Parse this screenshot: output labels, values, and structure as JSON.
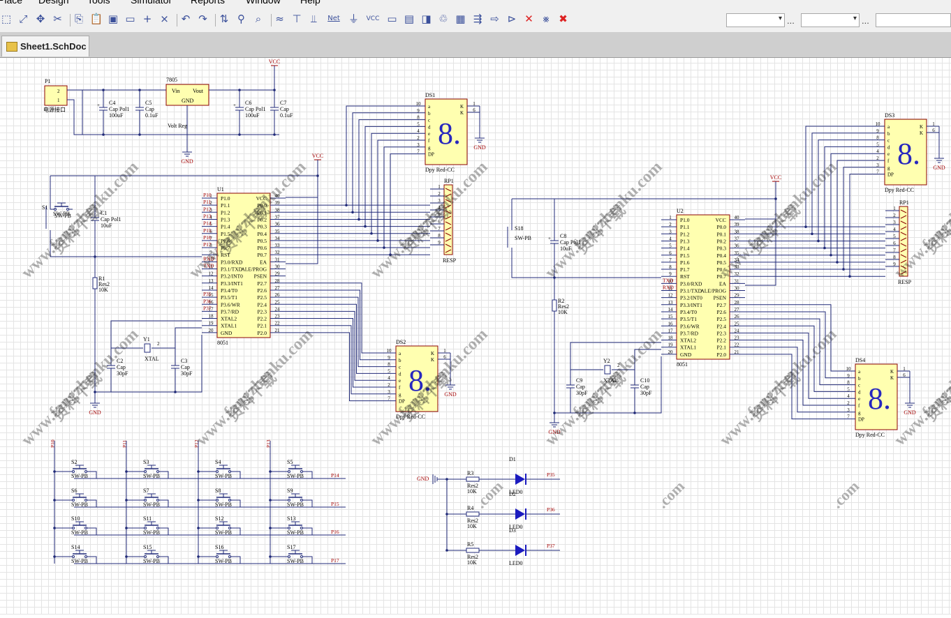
{
  "menu": [
    "Place",
    "Design",
    "Tools",
    "Simulator",
    "Reports",
    "Window",
    "Help"
  ],
  "tab": {
    "label": "Sheet1.SchDoc"
  },
  "toolbar": {
    "icons": [
      "select-area-icon",
      "select-icon",
      "move-icon",
      "cut-icon",
      "copy-icon",
      "paste-icon",
      "rubber-stamp-icon",
      "rectangle-select-icon",
      "cross-icon",
      "clear-icon",
      "undo-icon",
      "redo-icon",
      "parent-child-icon",
      "probe-icon",
      "browse-icon",
      "wire-icon",
      "bus-icon",
      "bus-entry-icon",
      "netlabel-icon",
      "gnd-port-icon",
      "vcc-port-icon",
      "part-icon",
      "sheet-icon",
      "sheet-entry-icon",
      "device-sheet-icon",
      "harness-icon",
      "port-icon",
      "off-sheet-icon",
      "no-erc-icon",
      "compile-icon",
      "cross-probe-icon",
      "delete-icon"
    ],
    "netlabel_text": "Net",
    "vcc_text": "VCC",
    "combo1": "",
    "combo2": "",
    "combo3": "",
    "ellipsis": "..."
  },
  "watermark": {
    "cn": "资料下载",
    "url": "www.fangzhenku.com",
    "tail": ".com"
  },
  "power": {
    "p1": {
      "ref": "P1",
      "pins": [
        "2",
        "1"
      ],
      "label": "电源接口"
    },
    "u7805": {
      "ref": "7805",
      "pin_in": "Vin",
      "pin_out": "Vout",
      "pin_gnd": "GND",
      "label": "Volt Reg"
    },
    "c4": {
      "ref": "C4",
      "type": "Cap Pol1",
      "value": "100uF"
    },
    "c5": {
      "ref": "C5",
      "type": "Cap",
      "value": "0.1uF"
    },
    "c6": {
      "ref": "C6",
      "type": "Cap Pol1",
      "value": "100uF"
    },
    "c7": {
      "ref": "C7",
      "type": "Cap",
      "value": "0.1uF"
    },
    "vcc": "VCC",
    "gnd": "GND"
  },
  "left_mcu": {
    "ref": "U1",
    "name": "8051",
    "left_pins": [
      {
        "num": "1",
        "name": "P1.0",
        "net": "P10"
      },
      {
        "num": "2",
        "name": "P1.1",
        "net": "P11"
      },
      {
        "num": "3",
        "name": "P1.2",
        "net": "P12"
      },
      {
        "num": "4",
        "name": "P1.3",
        "net": "P13"
      },
      {
        "num": "5",
        "name": "P1.4",
        "net": "P14"
      },
      {
        "num": "6",
        "name": "P1.5",
        "net": "P15"
      },
      {
        "num": "7",
        "name": "P1.6",
        "net": "P16"
      },
      {
        "num": "8",
        "name": "P1.7",
        "net": "P17"
      },
      {
        "num": "9",
        "name": "RST",
        "net": ""
      },
      {
        "num": "10",
        "name": "P3.0/RXD",
        "net": "RXD"
      },
      {
        "num": "11",
        "name": "P3.1/TXD",
        "net": "TXD"
      },
      {
        "num": "12",
        "name": "P3.2/INT0",
        "net": ""
      },
      {
        "num": "13",
        "name": "P3.3/INT1",
        "net": ""
      },
      {
        "num": "14",
        "name": "P3.4/T0",
        "net": ""
      },
      {
        "num": "15",
        "name": "P3.5/T1",
        "net": "P35"
      },
      {
        "num": "16",
        "name": "P3.6/WR",
        "net": "P36"
      },
      {
        "num": "17",
        "name": "P3.7/RD",
        "net": "P37"
      },
      {
        "num": "18",
        "name": "XTAL2",
        "net": ""
      },
      {
        "num": "19",
        "name": "XTAL1",
        "net": ""
      },
      {
        "num": "20",
        "name": "GND",
        "net": ""
      }
    ],
    "right_pins": [
      {
        "num": "40",
        "name": "VCC"
      },
      {
        "num": "39",
        "name": "P0.0"
      },
      {
        "num": "38",
        "name": "P0.1"
      },
      {
        "num": "37",
        "name": "P0.2"
      },
      {
        "num": "36",
        "name": "P0.3"
      },
      {
        "num": "35",
        "name": "P0.4"
      },
      {
        "num": "34",
        "name": "P0.5"
      },
      {
        "num": "33",
        "name": "P0.6"
      },
      {
        "num": "32",
        "name": "P0.7"
      },
      {
        "num": "31",
        "name": "EA"
      },
      {
        "num": "30",
        "name": "ALE/PROG"
      },
      {
        "num": "29",
        "name": "PSEN"
      },
      {
        "num": "28",
        "name": "P2.7"
      },
      {
        "num": "27",
        "name": "P2.6"
      },
      {
        "num": "26",
        "name": "P2.5"
      },
      {
        "num": "25",
        "name": "P2.4"
      },
      {
        "num": "24",
        "name": "P2.3"
      },
      {
        "num": "23",
        "name": "P2.2"
      },
      {
        "num": "22",
        "name": "P2.1"
      },
      {
        "num": "21",
        "name": "P2.0"
      }
    ],
    "vcc": "VCC",
    "s_reset": {
      "ref": "S1",
      "type": "SW-PB"
    },
    "c1": {
      "ref": "C1",
      "type": "Cap Pol1",
      "value": "10uF"
    },
    "r1": {
      "ref": "R1",
      "type": "Res2",
      "value": "10K"
    },
    "y1": {
      "ref": "Y1",
      "type": "XTAL"
    },
    "c2": {
      "ref": "C2",
      "type": "Cap",
      "value": "30pF"
    },
    "c3": {
      "ref": "C3",
      "type": "Cap",
      "value": "30pF"
    },
    "gnd": "GND"
  },
  "right_mcu": {
    "ref": "U2",
    "name": "8051",
    "left_pins": [
      {
        "num": "1",
        "name": "P1.0",
        "net": ""
      },
      {
        "num": "2",
        "name": "P1.1",
        "net": ""
      },
      {
        "num": "3",
        "name": "P1.2",
        "net": ""
      },
      {
        "num": "4",
        "name": "P1.3",
        "net": ""
      },
      {
        "num": "5",
        "name": "P1.4",
        "net": ""
      },
      {
        "num": "6",
        "name": "P1.5",
        "net": ""
      },
      {
        "num": "7",
        "name": "P1.6",
        "net": ""
      },
      {
        "num": "8",
        "name": "P1.7",
        "net": ""
      },
      {
        "num": "9",
        "name": "RST",
        "net": ""
      },
      {
        "num": "10",
        "name": "P3.0/RXD",
        "net": "TXD"
      },
      {
        "num": "11",
        "name": "P3.1/TXD",
        "net": "RXD"
      },
      {
        "num": "12",
        "name": "P3.2/INT0",
        "net": ""
      },
      {
        "num": "13",
        "name": "P3.3/INT1",
        "net": ""
      },
      {
        "num": "14",
        "name": "P3.4/T0",
        "net": ""
      },
      {
        "num": "15",
        "name": "P3.5/T1",
        "net": ""
      },
      {
        "num": "16",
        "name": "P3.6/WR",
        "net": ""
      },
      {
        "num": "17",
        "name": "P3.7/RD",
        "net": ""
      },
      {
        "num": "18",
        "name": "XTAL2",
        "net": ""
      },
      {
        "num": "19",
        "name": "XTAL1",
        "net": ""
      },
      {
        "num": "20",
        "name": "GND",
        "net": ""
      }
    ],
    "right_pins": [
      {
        "num": "40",
        "name": "VCC"
      },
      {
        "num": "39",
        "name": "P0.0"
      },
      {
        "num": "38",
        "name": "P0.1"
      },
      {
        "num": "37",
        "name": "P0.2"
      },
      {
        "num": "36",
        "name": "P0.3"
      },
      {
        "num": "35",
        "name": "P0.4"
      },
      {
        "num": "34",
        "name": "P0.5"
      },
      {
        "num": "33",
        "name": "P0.6"
      },
      {
        "num": "32",
        "name": "P0.7"
      },
      {
        "num": "31",
        "name": "EA"
      },
      {
        "num": "30",
        "name": "ALE/PROG"
      },
      {
        "num": "29",
        "name": "PSEN"
      },
      {
        "num": "28",
        "name": "P2.7"
      },
      {
        "num": "27",
        "name": "P2.6"
      },
      {
        "num": "26",
        "name": "P2.5"
      },
      {
        "num": "25",
        "name": "P2.4"
      },
      {
        "num": "24",
        "name": "P2.3"
      },
      {
        "num": "23",
        "name": "P2.2"
      },
      {
        "num": "22",
        "name": "P2.1"
      },
      {
        "num": "21",
        "name": "P2.0"
      }
    ],
    "vcc": "VCC",
    "s_reset": {
      "ref": "S18",
      "type": "SW-PB"
    },
    "c8": {
      "ref": "C8",
      "type": "Cap Pol1",
      "value": "10uF"
    },
    "r2": {
      "ref": "R2",
      "type": "Res2",
      "value": "10K"
    },
    "y2": {
      "ref": "Y2",
      "type": "XTAL"
    },
    "c9": {
      "ref": "C9",
      "type": "Cap",
      "value": "30pF"
    },
    "c10": {
      "ref": "C10",
      "type": "Cap",
      "value": "30pF"
    },
    "gnd": "GND"
  },
  "resp": {
    "ref": "RP1",
    "type": "RESP",
    "pins": [
      "1",
      "2",
      "3",
      "4",
      "5",
      "6",
      "7",
      "8",
      "9"
    ]
  },
  "displays": {
    "seg_pins": [
      {
        "num": "10",
        "seg": "a"
      },
      {
        "num": "9",
        "seg": "b"
      },
      {
        "num": "8",
        "seg": "c"
      },
      {
        "num": "5",
        "seg": "d"
      },
      {
        "num": "4",
        "seg": "e"
      },
      {
        "num": "2",
        "seg": "f"
      },
      {
        "num": "3",
        "seg": "g"
      },
      {
        "num": "7",
        "seg": "DP"
      }
    ],
    "com_pins": [
      {
        "num": "1",
        "name": "K"
      },
      {
        "num": "6",
        "name": "K"
      }
    ],
    "type": "Dpy Red-CC",
    "digit": "8.",
    "ds1": "DS1",
    "ds2": "DS2",
    "ds3": "DS3",
    "ds4": "DS4",
    "gnd": "GND"
  },
  "keypad": {
    "cols": [
      "P10",
      "P11",
      "P12",
      "P13"
    ],
    "rows": [
      "P14",
      "P15",
      "P16",
      "P17"
    ],
    "switches": [
      "S2",
      "S3",
      "S4",
      "S5",
      "S6",
      "S7",
      "S8",
      "S9",
      "S10",
      "S11",
      "S12",
      "S13",
      "S14",
      "S15",
      "S16",
      "S17"
    ],
    "type": "SW-PB"
  },
  "leds": {
    "gnd": "GND",
    "items": [
      {
        "r": "R3",
        "res": "Res2",
        "val": "10K",
        "d": "D1",
        "led": "LED0",
        "net": "P35"
      },
      {
        "r": "R4",
        "res": "Res2",
        "val": "10K",
        "d": "D2",
        "led": "LED0",
        "net": "P36"
      },
      {
        "r": "R5",
        "res": "Res2",
        "val": "10K",
        "d": "D3",
        "led": "LED0",
        "net": "P37"
      }
    ]
  }
}
